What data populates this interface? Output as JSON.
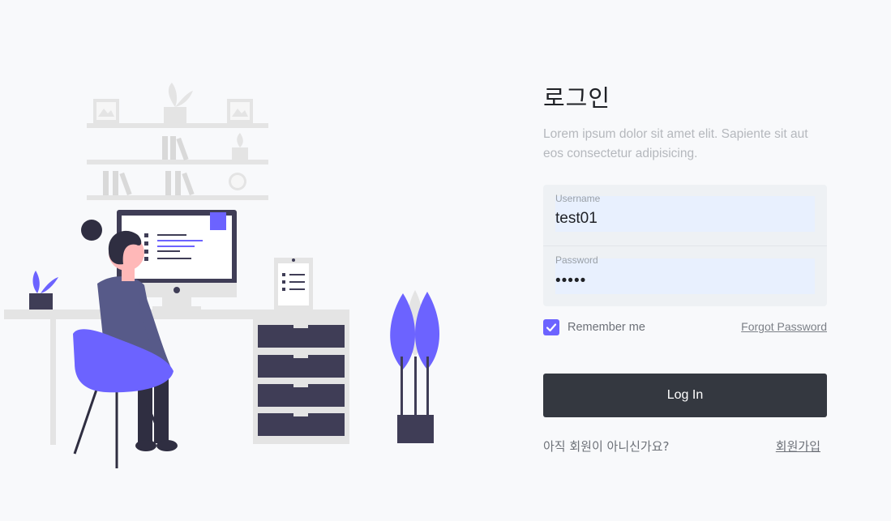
{
  "login": {
    "title": "로그인",
    "subtitle": "Lorem ipsum dolor sit amet elit. Sapiente sit aut eos consectetur adipisicing.",
    "username": {
      "label": "Username",
      "value": "test01"
    },
    "password": {
      "label": "Password",
      "value": "•••••"
    },
    "remember_label": "Remember me",
    "remember_checked": true,
    "forgot_label": "Forgot Password",
    "submit_label": "Log In",
    "signup_question": "아직 회원이 아니신가요?",
    "signup_link": "회원가입"
  },
  "colors": {
    "accent": "#6c63ff",
    "button": "#343840",
    "input_bg": "#e8f0fe",
    "background": "#f8f9fb"
  },
  "icons": [
    "checkbox-check-icon"
  ]
}
